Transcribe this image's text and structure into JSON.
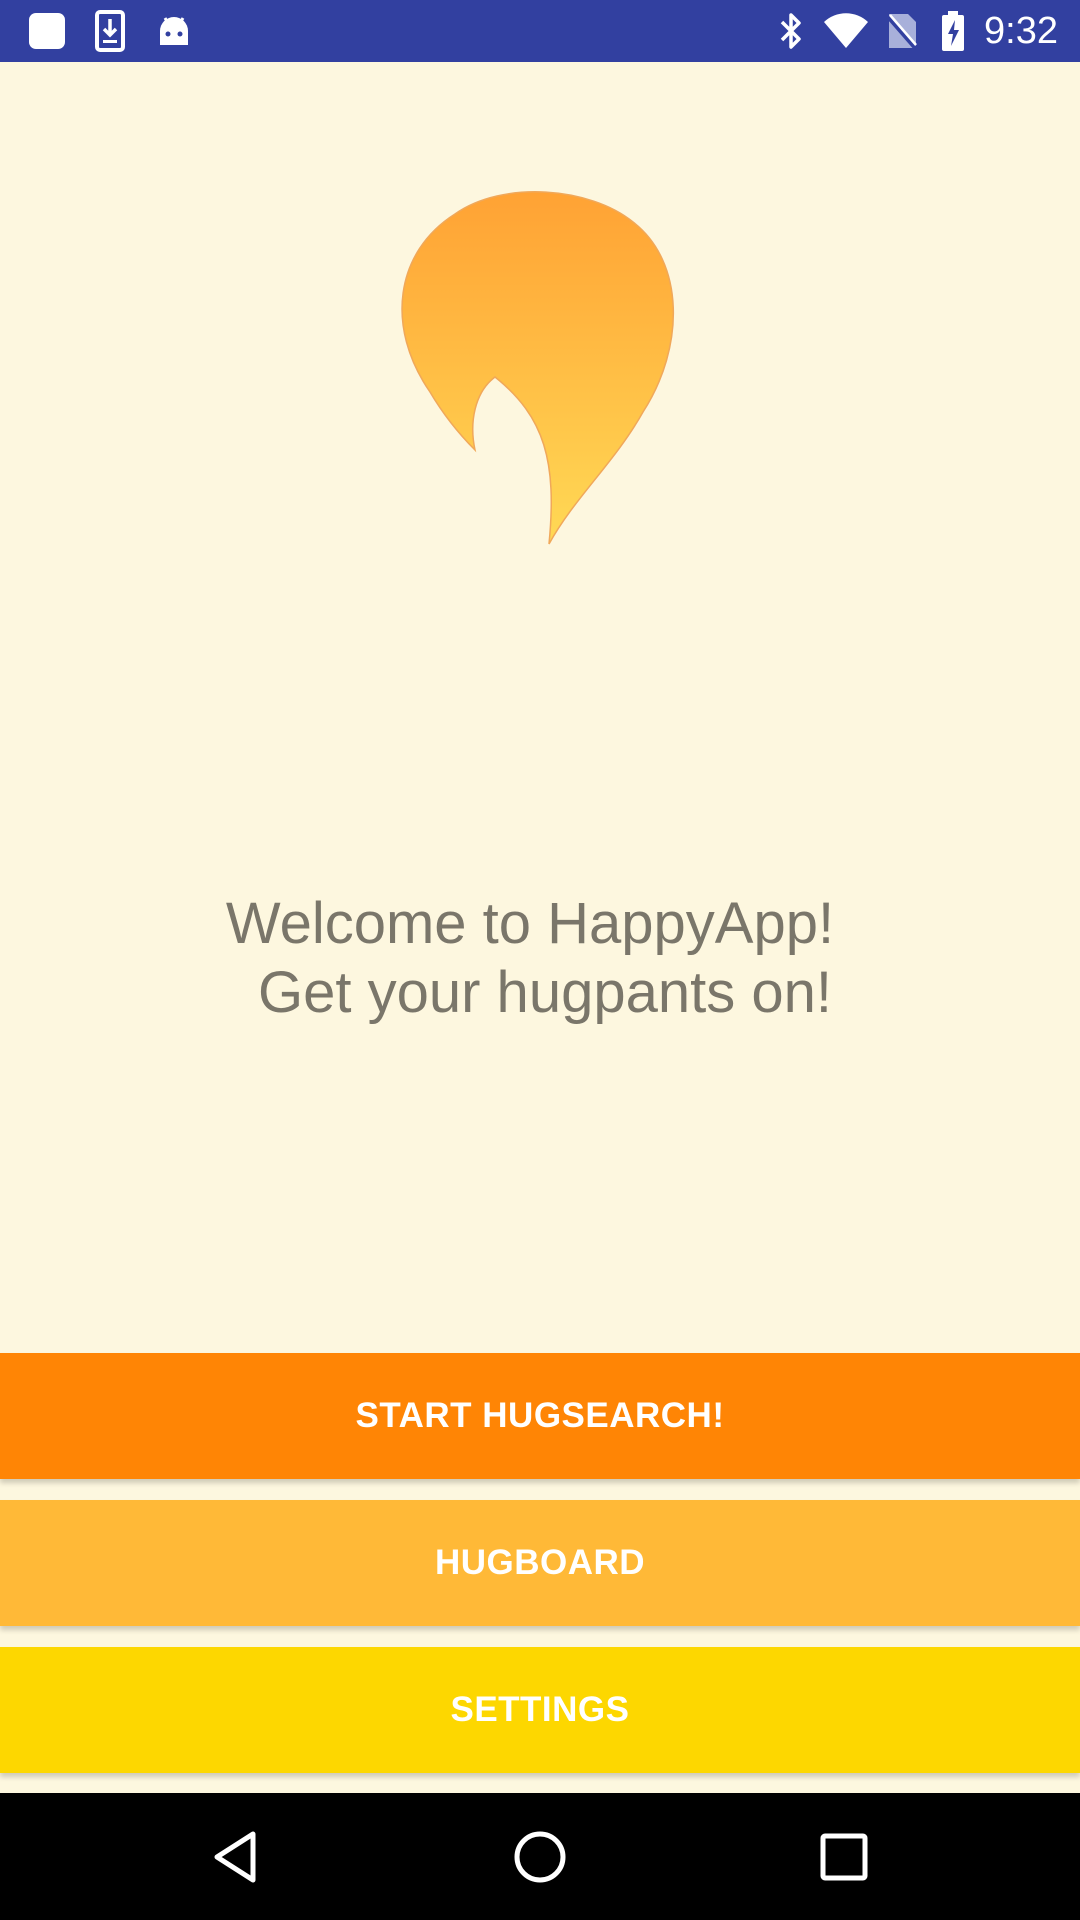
{
  "status_bar": {
    "time": "9:32",
    "background": "#3240a0",
    "left_icons": [
      "notification-square-icon",
      "download-icon",
      "android-icon"
    ],
    "right_icons": [
      "bluetooth-icon",
      "wifi-icon",
      "no-sim-icon",
      "battery-charging-icon"
    ]
  },
  "main": {
    "background": "#fdf7df",
    "logo_icon": "flame-logo-icon",
    "welcome_line1": "Welcome to HappyApp!",
    "welcome_line2": "Get your hugpants on!",
    "text_color": "#7a766a"
  },
  "buttons": {
    "start_label": "START HUGSEARCH!",
    "start_color": "#ff8505",
    "hugboard_label": "HUGBOARD",
    "hugboard_color": "#ffb937",
    "settings_label": "SETTINGS",
    "settings_color": "#fdd700"
  },
  "nav_bar": {
    "icons": [
      "back-icon",
      "home-icon",
      "recents-icon"
    ]
  }
}
